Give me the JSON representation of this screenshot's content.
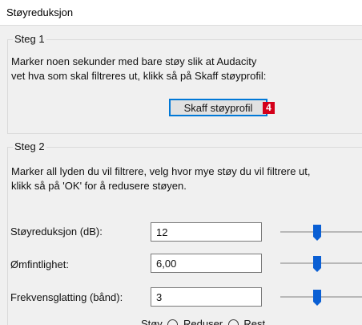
{
  "window": {
    "title": "Støyreduksjon"
  },
  "step1": {
    "legend": "Steg 1",
    "line1": "Marker noen sekunder med bare støy slik at Audacity",
    "line2": "vet hva som skal filtreres ut, klikk så på Skaff støyprofil:",
    "button_label": "Skaff støyprofil",
    "badge": "4"
  },
  "step2": {
    "legend": "Steg 2",
    "line1": "Marker all lyden du vil filtrere, velg hvor mye støy du vil filtrere ut,",
    "line2": "klikk så på 'OK' for å redusere støyen.",
    "fields": [
      {
        "label": "Støyreduksjon (dB):",
        "value": "12"
      },
      {
        "label": "Ømfintlighet:",
        "value": "6,00"
      },
      {
        "label": "Frekvensglatting (bånd):",
        "value": "3"
      }
    ],
    "partial_row": {
      "label": "Støy",
      "option1": "Reduser",
      "option2": "Rest"
    }
  }
}
